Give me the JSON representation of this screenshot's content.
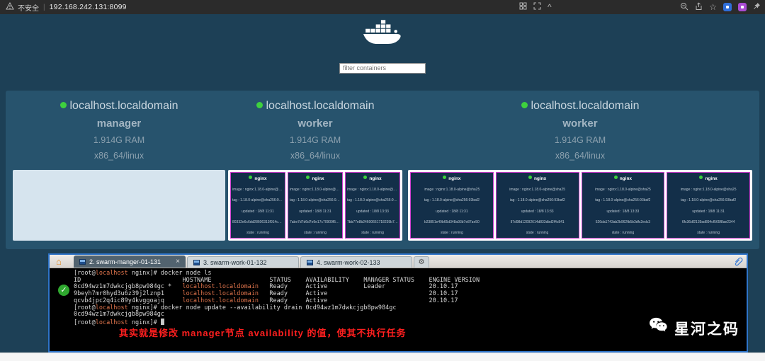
{
  "browser": {
    "security_label": "不安全",
    "separator": "|",
    "url": "192.168.242.131:8099"
  },
  "page": {
    "filter_placeholder": "filter containers"
  },
  "icons": {
    "home": "⌂",
    "gear": "⚙",
    "close": "×",
    "check": "✓",
    "star": "☆",
    "chevron_up": "^"
  },
  "nodes": [
    {
      "name": "localhost.localdomain",
      "role": "manager",
      "ram": "1.914G RAM",
      "platform": "x86_64/linux",
      "containers": []
    },
    {
      "name": "localhost.localdomain",
      "role": "worker",
      "ram": "1.914G RAM",
      "platform": "x86_64/linux",
      "containers": [
        {
          "title": "nginx",
          "image": "image : nginx:1.18.0-alpine@sha25",
          "tag": "tag : 1.18.0-alpine@sha256:93baf2",
          "updated": "updated : 18/8 11:31",
          "hash": "80332e6c6dd28606313f914cbcb48",
          "state": "state : running"
        },
        {
          "title": "nginx",
          "image": "image : nginx:1.18.0-alpine@sha25",
          "tag": "tag : 1.18.0-alpine@sha256:93baf2",
          "updated": "updated : 18/8 11:31",
          "hash": "7abe7d7d6d7e9e17c70909f571aa4",
          "state": "state : running"
        },
        {
          "title": "nginx",
          "image": "image : nginx:1.18.0-alpine@sha25",
          "tag": "tag : 1.18.0-alpine@sha256:93baf2",
          "updated": "updated : 18/8 13:33",
          "hash": "7bb77e8b24600661718239b73570",
          "state": "state : running"
        }
      ]
    },
    {
      "name": "localhost.localdomain",
      "role": "worker",
      "ram": "1.914G RAM",
      "platform": "x86_64/linux",
      "containers": [
        {
          "title": "nginx",
          "image": "image : nginx:1.18.0-alpine@sha25",
          "tag": "tag : 1.18.0-alpine@sha256:93baf2",
          "updated": "updated : 18/8 11:31",
          "hash": "b23851e49b65d348a93b7e87ae50",
          "state": "state : running"
        },
        {
          "title": "nginx",
          "image": "image : nginx:1.18.0-alpine@sha25",
          "tag": "tag : 1.18.0-alpine@sha256:93baf2",
          "updated": "updated : 18/8 13:33",
          "hash": "87d98d12092614d833dbd2f4c841",
          "state": "state : running"
        },
        {
          "title": "nginx",
          "image": "image : nginx:1.18.0-alpine@sha25",
          "tag": "tag : 1.18.0-alpine@sha256:93baf2",
          "updated": "updated : 18/8 13:33",
          "hash": "526da1743ab2b962fb5b3dfc2edc3",
          "state": "state : running"
        },
        {
          "title": "nginx",
          "image": "image : nginx:1.18.0-alpine@sha25",
          "tag": "tag : 1.18.0-alpine@sha256:93baf2",
          "updated": "updated : 18/8 11:31",
          "hash": "6fc36df2139ad894cf565f8ae2344",
          "state": "state : running"
        }
      ]
    }
  ],
  "terminal": {
    "tabs": [
      {
        "label": "2. swarm-manger-01-131",
        "active": true
      },
      {
        "label": "3. swarm-work-01-132",
        "active": false
      },
      {
        "label": "4. swarm-work-02-133",
        "active": false
      }
    ],
    "lines": [
      {
        "segments": [
          {
            "t": "[root@"
          },
          {
            "t": "localhost",
            "c": "h"
          },
          {
            "t": " nginx]# docker node ls"
          }
        ]
      },
      {
        "segments": [
          {
            "t": "ID                            HOSTNAME                STATUS    AVAILABILITY    MANAGER STATUS    ENGINE VERSION"
          }
        ]
      },
      {
        "segments": [
          {
            "t": "0cd94wz1m7dwkcjgb8pw984gc *   "
          },
          {
            "t": "localhost.localdomain",
            "c": "h"
          },
          {
            "t": "   Ready     Active          Leader            20.10.17"
          }
        ]
      },
      {
        "segments": [
          {
            "t": "9beyh7mr0hyd3u6z39j2lznp1     "
          },
          {
            "t": "localhost.localdomain",
            "c": "h"
          },
          {
            "t": "   Ready     Active                            20.10.17"
          }
        ]
      },
      {
        "segments": [
          {
            "t": "qcvb4jpc2q4ic89y4kvggoajq     "
          },
          {
            "t": "localhost.localdomain",
            "c": "h"
          },
          {
            "t": "   Ready     Active                            20.10.17"
          }
        ]
      },
      {
        "segments": [
          {
            "t": "[root@"
          },
          {
            "t": "localhost",
            "c": "h"
          },
          {
            "t": " nginx]# docker node update --availability drain 0cd94wz1m7dwkcjgb8pw984gc"
          }
        ]
      },
      {
        "segments": [
          {
            "t": "0cd94wz1m7dwkcjgb8pw984gc"
          }
        ]
      },
      {
        "segments": [
          {
            "t": "[root@"
          },
          {
            "t": "localhost",
            "c": "h"
          },
          {
            "t": " nginx]# "
          },
          {
            "t": " ",
            "c": "cursor"
          }
        ]
      }
    ],
    "annotation": "其实就是修改 manager节点 availability 的值，使其不执行任务"
  },
  "watermark": {
    "label": "星河之码"
  }
}
